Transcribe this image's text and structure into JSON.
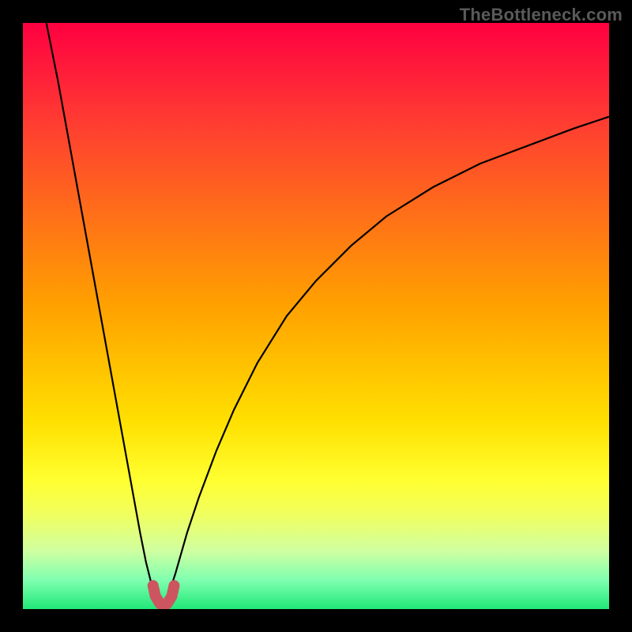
{
  "watermark": "TheBottleneck.com",
  "colors": {
    "frame": "#000000",
    "gradient_top": "#ff0040",
    "gradient_bottom": "#20e878",
    "curve": "#000000",
    "notch": "#cc5560",
    "watermark": "#5a5a5a"
  },
  "chart_data": {
    "type": "line",
    "title": "",
    "xlabel": "",
    "ylabel": "",
    "xlim": [
      0,
      100
    ],
    "ylim": [
      0,
      100
    ],
    "grid": false,
    "legend": false,
    "annotations": [
      "TheBottleneck.com"
    ],
    "x_min_point": 24,
    "series": [
      {
        "name": "left-branch",
        "x": [
          4,
          6,
          8,
          10,
          12,
          14,
          16,
          18,
          20,
          21,
          22,
          23,
          24
        ],
        "y": [
          100,
          90,
          79,
          68,
          57,
          46,
          35,
          24,
          13,
          8,
          4,
          1.5,
          0
        ]
      },
      {
        "name": "right-branch",
        "x": [
          24,
          26,
          28,
          30,
          33,
          36,
          40,
          45,
          50,
          56,
          62,
          70,
          78,
          86,
          94,
          100
        ],
        "y": [
          0,
          6,
          13,
          19,
          27,
          34,
          42,
          50,
          56,
          62,
          67,
          72,
          76,
          79,
          82,
          84
        ]
      },
      {
        "name": "notch-highlight",
        "x": [
          22.2,
          22.6,
          23.4,
          24.0,
          24.6,
          25.4,
          25.8
        ],
        "y": [
          4.0,
          2.2,
          0.9,
          0.6,
          0.9,
          2.2,
          4.0
        ]
      }
    ]
  }
}
